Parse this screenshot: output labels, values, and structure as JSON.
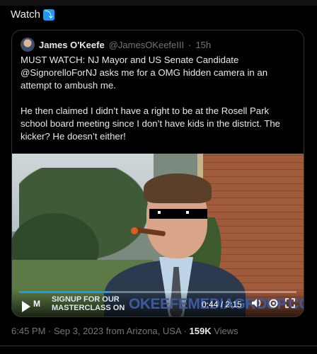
{
  "header": {
    "label": "Watch",
    "emoji": "⤵"
  },
  "tweet": {
    "author_name": "James O'Keefe",
    "author_handle": "@JamesOKeefeIII",
    "separator": "·",
    "time": "15h",
    "text": "MUST WATCH: NJ Mayor and US Senate Candidate @SignorelloForNJ asks me for a OMG hidden camera in an attempt to ambush me.\n\nHe then claimed I didn’t have a right to be at the Rosell Park school board meeting since I don’t have kids in the district. The kicker? He doesn’t either!"
  },
  "video": {
    "banner_line1": "SIGNUP FOR OUR",
    "banner_line2": "MASTERCLASS ON",
    "banner_site": "OKEEFEMEDIAGROUP.COM",
    "time_display": "0:44 / 2:15",
    "progress": 0.326,
    "icons": {
      "logo": "M",
      "volume": "volume-icon",
      "settings": "settings-icon",
      "fullscreen": "fullscreen-icon"
    }
  },
  "footer": {
    "timestamp": "6:45 PM · Sep 3, 2023 from Arizona, USA",
    "separator": "·",
    "views_count": "159K",
    "views_label": "Views"
  },
  "colors": {
    "accent": "#1d9bf0",
    "background": "#000000",
    "muted": "#71767b"
  }
}
